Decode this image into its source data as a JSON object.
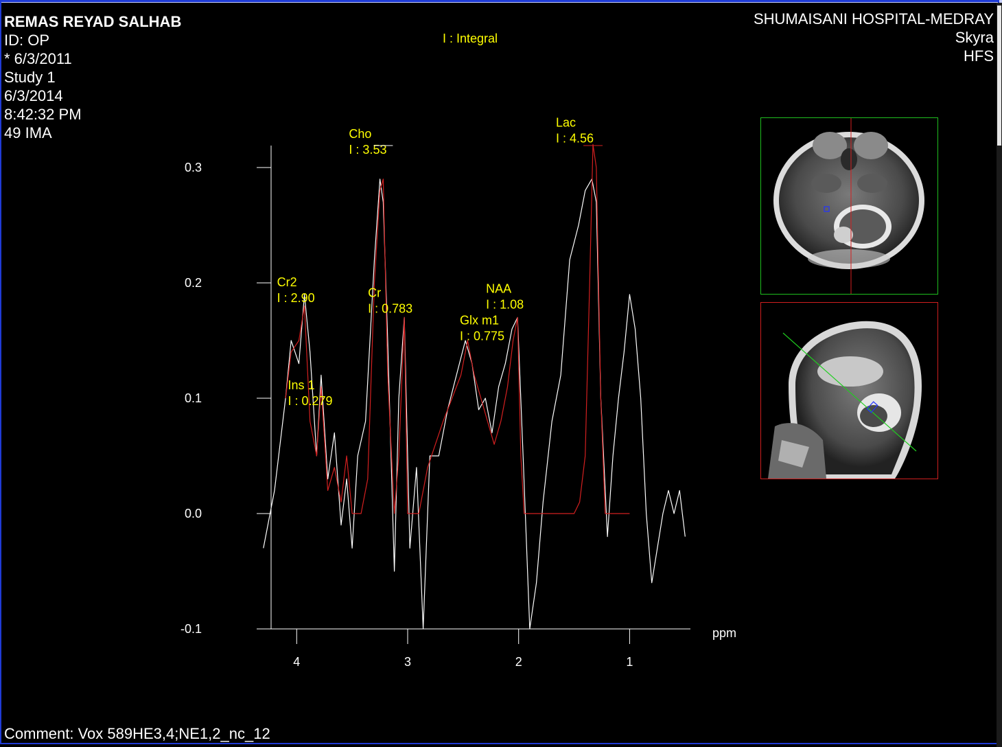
{
  "patient": {
    "name": "REMAS REYAD SALHAB",
    "id": "ID: OP",
    "dob": "* 6/3/2011",
    "study": "Study 1",
    "date": "6/3/2014",
    "time": "8:42:32 PM",
    "images": "49 IMA"
  },
  "site": {
    "hospital": "SHUMAISANI HOSPITAL-MEDRAY",
    "scanner": "Skyra",
    "position": "HFS"
  },
  "legend": "I : Integral",
  "comment": "Comment: Vox 589HE3,4;NE1,2_nc_12",
  "colors": {
    "raw": "#ffffff",
    "fit": "#d42020",
    "label": "#ffff00",
    "border": "#1f3bd6"
  },
  "chart_data": {
    "type": "line",
    "xlabel": "ppm",
    "x_reversed": true,
    "xlim": [
      4.3,
      0.5
    ],
    "ylim": [
      -0.1,
      0.32
    ],
    "x_ticks": [
      "4",
      "3",
      "2",
      "1"
    ],
    "x_tick_values": [
      4,
      3,
      2,
      1
    ],
    "y_ticks": [
      "0.3",
      "0.2",
      "0.1",
      "0.0",
      "-0.1"
    ],
    "y_tick_values": [
      0.3,
      0.2,
      0.1,
      0.0,
      -0.1
    ],
    "peaks": [
      {
        "name": "Cr2",
        "integral": "I : 2.90",
        "ppm": 3.93,
        "height": 0.19
      },
      {
        "name": "Ins 1",
        "integral": "I : 0.279",
        "ppm": 3.56,
        "height": 0.06
      },
      {
        "name": "Cho",
        "integral": "I : 3.53",
        "ppm": 3.22,
        "height": 0.29
      },
      {
        "name": "Cr",
        "integral": "I : 0.783",
        "ppm": 3.03,
        "height": 0.17
      },
      {
        "name": "Glx m1",
        "integral": "I : 0.775",
        "ppm": 2.4,
        "height": 0.13
      },
      {
        "name": "NAA",
        "integral": "I : 1.08",
        "ppm": 2.01,
        "height": 0.17
      },
      {
        "name": "Lac",
        "integral": "I : 4.56",
        "ppm": 1.33,
        "height": 0.32
      }
    ],
    "raw_series": {
      "name": "",
      "x": [
        4.3,
        4.2,
        4.1,
        4.05,
        3.98,
        3.93,
        3.88,
        3.82,
        3.78,
        3.72,
        3.66,
        3.6,
        3.55,
        3.5,
        3.45,
        3.38,
        3.3,
        3.25,
        3.22,
        3.18,
        3.12,
        3.08,
        3.03,
        2.98,
        2.92,
        2.86,
        2.8,
        2.72,
        2.64,
        2.56,
        2.48,
        2.42,
        2.36,
        2.3,
        2.24,
        2.18,
        2.12,
        2.06,
        2.01,
        1.96,
        1.9,
        1.84,
        1.78,
        1.7,
        1.62,
        1.54,
        1.46,
        1.4,
        1.34,
        1.3,
        1.26,
        1.2,
        1.15,
        1.1,
        1.05,
        1.0,
        0.95,
        0.9,
        0.85,
        0.8,
        0.75,
        0.7,
        0.65,
        0.6,
        0.55,
        0.5
      ],
      "y": [
        -0.03,
        0.02,
        0.1,
        0.15,
        0.13,
        0.19,
        0.14,
        0.05,
        0.12,
        0.03,
        0.07,
        -0.01,
        0.03,
        -0.03,
        0.05,
        0.08,
        0.22,
        0.29,
        0.27,
        0.15,
        -0.05,
        0.1,
        0.17,
        -0.03,
        0.04,
        -0.1,
        0.05,
        0.05,
        0.09,
        0.12,
        0.15,
        0.13,
        0.09,
        0.1,
        0.07,
        0.11,
        0.13,
        0.16,
        0.17,
        0.05,
        -0.1,
        -0.06,
        0.01,
        0.08,
        0.12,
        0.22,
        0.25,
        0.28,
        0.29,
        0.27,
        0.1,
        -0.02,
        0.05,
        0.1,
        0.14,
        0.19,
        0.16,
        0.1,
        0.0,
        -0.06,
        -0.03,
        0.0,
        0.02,
        0.0,
        0.02,
        -0.02
      ]
    },
    "fit_series": {
      "name": "",
      "x": [
        4.1,
        4.05,
        3.98,
        3.93,
        3.88,
        3.82,
        3.78,
        3.72,
        3.66,
        3.6,
        3.55,
        3.5,
        3.42,
        3.36,
        3.3,
        3.25,
        3.22,
        3.18,
        3.12,
        3.08,
        3.03,
        3.0,
        2.95,
        2.9,
        2.82,
        2.75,
        2.68,
        2.6,
        2.52,
        2.46,
        2.4,
        2.34,
        2.28,
        2.22,
        2.16,
        2.1,
        2.05,
        2.01,
        1.98,
        1.95,
        1.9,
        1.8,
        1.7,
        1.6,
        1.5,
        1.45,
        1.4,
        1.36,
        1.33,
        1.3,
        1.26,
        1.22,
        1.18,
        1.1,
        1.0
      ],
      "y": [
        0.1,
        0.14,
        0.15,
        0.18,
        0.08,
        0.05,
        0.11,
        0.02,
        0.04,
        0.01,
        0.05,
        0.0,
        0.0,
        0.03,
        0.2,
        0.28,
        0.29,
        0.12,
        0.0,
        0.05,
        0.17,
        0.0,
        0.0,
        0.0,
        0.04,
        0.06,
        0.08,
        0.1,
        0.12,
        0.15,
        0.12,
        0.1,
        0.08,
        0.06,
        0.08,
        0.11,
        0.15,
        0.17,
        0.05,
        0.0,
        0.0,
        0.0,
        0.0,
        0.0,
        0.0,
        0.01,
        0.05,
        0.2,
        0.32,
        0.3,
        0.1,
        0.0,
        0.0,
        0.0,
        0.0
      ]
    }
  }
}
